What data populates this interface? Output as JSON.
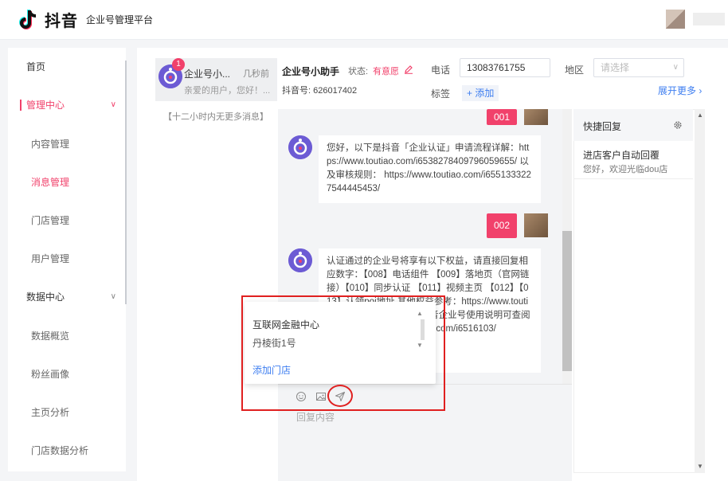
{
  "header": {
    "brand": "抖音",
    "subtitle": "企业号管理平台"
  },
  "sidebar": {
    "items": [
      {
        "label": "首页",
        "kind": "top"
      },
      {
        "label": "管理中心",
        "kind": "group-active"
      },
      {
        "label": "内容管理",
        "kind": "sub"
      },
      {
        "label": "消息管理",
        "kind": "sub-active"
      },
      {
        "label": "门店管理",
        "kind": "sub"
      },
      {
        "label": "用户管理",
        "kind": "sub"
      },
      {
        "label": "数据中心",
        "kind": "group"
      },
      {
        "label": "数据概览",
        "kind": "sub"
      },
      {
        "label": "粉丝画像",
        "kind": "sub"
      },
      {
        "label": "主页分析",
        "kind": "sub"
      },
      {
        "label": "门店数据分析",
        "kind": "sub"
      }
    ]
  },
  "conversation": {
    "badge": "1",
    "name": "企业号小...",
    "time": "几秒前",
    "preview": "亲爱的用户，您好！...",
    "no_more": "【十二小时内无更多消息】"
  },
  "chat_header": {
    "name": "企业号小助手",
    "status_label": "状态:",
    "status_value": "有意愿",
    "id_text": "抖音号: 626017402",
    "phone_label": "电话",
    "phone_value": "13083761755",
    "region_label": "地区",
    "region_placeholder": "请选择",
    "tag_label": "标签",
    "tag_add": "+ 添加",
    "expand": "展开更多"
  },
  "messages": {
    "m1_num": "001",
    "m2_text": "您好，以下是抖音「企业认证」申请流程详解：https://www.toutiao.com/i6538278409796059655/ 以及审核规则： https://www.toutiao.com/i6551333227544445453/",
    "m3_num": "002",
    "m4_text": "认证通过的企业号将享有以下权益，请直接回复相应数字：【008】电话组件 【009】落地页（官网链接）【010】同步认证 【011】视频主页 【012】【013】认领poi地址 其他权益参考：https://www.toutiao.com/i6542788/ 另附抖音企业号使用说明可查阅操作哦 https://www.toutiao.com/i6516103/"
  },
  "store_popup": {
    "store_name": "互联网金融中心",
    "store_address": "丹棱街1号",
    "add_store": "添加门店"
  },
  "input": {
    "placeholder": "回复内容"
  },
  "quick_reply": {
    "title": "快捷回复",
    "item_title": "进店客户自动回覆",
    "item_desc": "您好，欢迎光临dou店"
  },
  "colors": {
    "accent": "#f1416b",
    "link": "#3e7ef0",
    "annotation": "#e02020"
  }
}
